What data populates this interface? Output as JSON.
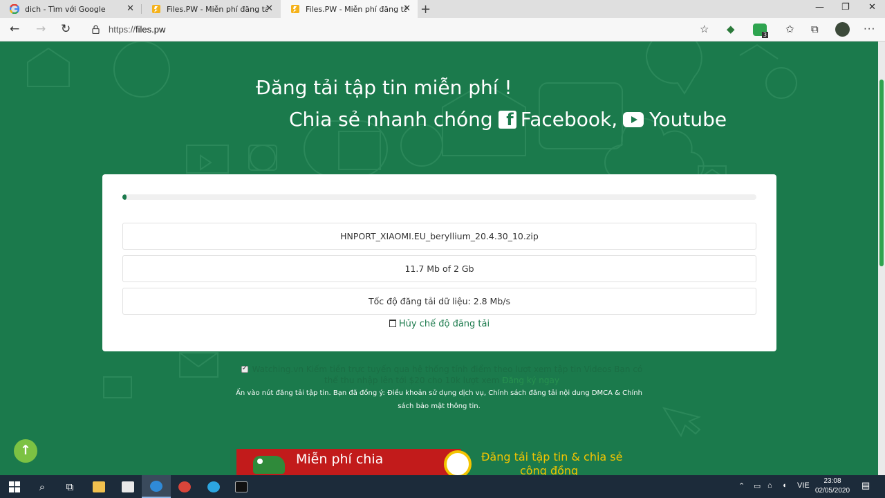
{
  "browser": {
    "tabs": [
      {
        "title": "dich - Tìm với Google",
        "favicon": "google-icon",
        "active": false
      },
      {
        "title": "Files.PW - Miễn phí đăng tải & chia sẻ",
        "favicon": "files-pw-icon",
        "active": false
      },
      {
        "title": "Files.PW - Miễn phí đăng tải & chia sẻ",
        "favicon": "files-pw-icon",
        "active": true
      }
    ],
    "close_glyph": "✕",
    "new_tab_glyph": "+",
    "url_prefix": "https://",
    "url_host": "files.pw",
    "extension_badge_count": "3",
    "accent": "#2ea44f"
  },
  "page": {
    "hero_line1": "Đăng tải tập tin miễn phí !",
    "hero_line2_prefix": "Chia sẻ nhanh chóng",
    "hero_facebook": "Facebook,",
    "hero_youtube": "Youtube",
    "brand_color": "#1b7a4c",
    "upload": {
      "progress_fraction": 0.005,
      "file_name": "HNPORT_XIAOMI.EU_beryllium_20.4.30_10.zip",
      "size_text": "11.7 Mb of 2 Gb",
      "speed_text": "Tốc độ đăng tải dữ liệu: 2.8 Mb/s",
      "cancel_text": "Hủy chế độ đăng tải"
    },
    "promo_text": "Watching.vn Kiếm tiền trực tuyến qua hệ thống tính điểm theo lượt xem tập tin Videos Bạn có thể thu nhập lên tới $20 cho 10k lượt xem",
    "promo_link": "Đăng ký ngay",
    "terms_text": "Ấn vào nút đăng tải tập tin. Bạn đã đồng ý: Điều khoản sử dụng dịch vụ, Chính sách đăng tải nội dung DMCA & Chính sách bảo mật thông tin.",
    "banner": {
      "left_text": "Miễn phí chia",
      "right_line1": "Đăng tải tập tin & chia sẻ",
      "right_line2": "cộng đồng"
    },
    "scroll_top_glyph": "↑"
  },
  "taskbar": {
    "language": "VIE",
    "time": "23:08",
    "date": "02/05/2020"
  }
}
